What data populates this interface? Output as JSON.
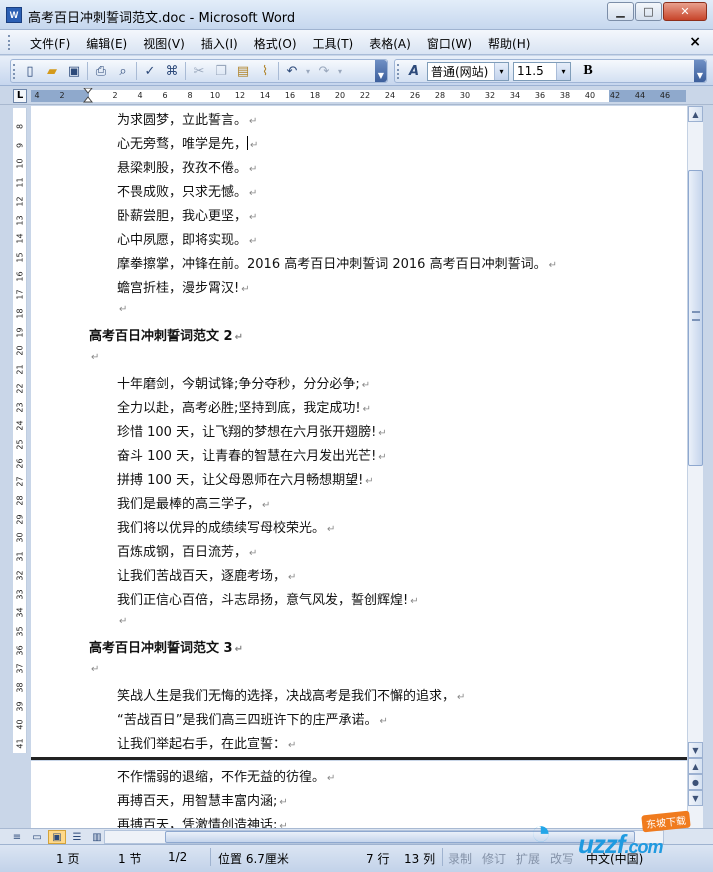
{
  "window": {
    "title": "高考百日冲刺誓词范文.doc - Microsoft Word",
    "app_icon_label": "W",
    "minimize_glyph": "▁",
    "maximize_glyph": "□",
    "close_glyph": "✕"
  },
  "menu": {
    "items": [
      "文件(F)",
      "编辑(E)",
      "视图(V)",
      "插入(I)",
      "格式(O)",
      "工具(T)",
      "表格(A)",
      "窗口(W)",
      "帮助(H)"
    ],
    "close_glyph": "×"
  },
  "toolbar": {
    "style_value": "普通(网站)",
    "font_size_value": "11.5",
    "bold_label": "B",
    "styles_icon_label": "A"
  },
  "ruler": {
    "corner_label": "L",
    "h_ticks": [
      "4",
      "2",
      "2",
      "4",
      "6",
      "8",
      "10",
      "12",
      "14",
      "16",
      "18",
      "20",
      "22",
      "24",
      "26",
      "28",
      "30",
      "32",
      "34",
      "36",
      "38",
      "40",
      "42",
      "44",
      "46"
    ],
    "v_ticks": [
      "8",
      "9",
      "10",
      "11",
      "12",
      "13",
      "14",
      "15",
      "16",
      "17",
      "18",
      "19",
      "20",
      "21",
      "22",
      "23",
      "24",
      "25",
      "26",
      "27",
      "28",
      "29",
      "30",
      "31",
      "32",
      "33",
      "34",
      "35",
      "36",
      "37",
      "38",
      "39",
      "40",
      "41"
    ]
  },
  "document": {
    "para_mark": "↵",
    "lines": [
      {
        "text": "为求圆梦，立此誓言。",
        "indent": 1
      },
      {
        "text": "心无旁骛，唯学是先，",
        "indent": 1,
        "caret": true
      },
      {
        "text": "悬梁刺股，孜孜不倦。",
        "indent": 1
      },
      {
        "text": "不畏成败，只求无憾。",
        "indent": 1
      },
      {
        "text": "卧薪尝胆，我心更坚，",
        "indent": 1
      },
      {
        "text": "心中夙愿，即将实现。",
        "indent": 1
      },
      {
        "text": "摩拳擦掌，冲锋在前。2016 高考百日冲刺誓词 2016 高考百日冲刺誓词。",
        "indent": 1
      },
      {
        "text": "蟾宫折桂，漫步霄汉!",
        "indent": 1
      },
      {
        "text": "",
        "indent": 1
      },
      {
        "text": "高考百日冲刺誓词范文 2",
        "indent": 0,
        "heading": true
      },
      {
        "text": "",
        "indent": 0
      },
      {
        "text": "十年磨剑，今朝试锋;争分夺秒，分分必争;",
        "indent": 1
      },
      {
        "text": "全力以赴，高考必胜;坚持到底，我定成功!",
        "indent": 1
      },
      {
        "text": "珍惜 100 天，让飞翔的梦想在六月张开翅膀!",
        "indent": 1
      },
      {
        "text": "奋斗 100 天，让青春的智慧在六月发出光芒!",
        "indent": 1
      },
      {
        "text": "拼搏 100 天，让父母恩师在六月畅想期望!",
        "indent": 1
      },
      {
        "text": "我们是最棒的高三学子，",
        "indent": 1
      },
      {
        "text": "我们将以优异的成绩续写母校荣光。",
        "indent": 1
      },
      {
        "text": "百炼成钢，百日流芳，",
        "indent": 1
      },
      {
        "text": "让我们苦战百天，逐鹿考场，",
        "indent": 1
      },
      {
        "text": "我们正信心百倍，斗志昂扬，意气风发，誓创辉煌!",
        "indent": 1
      },
      {
        "text": "",
        "indent": 1
      },
      {
        "text": "高考百日冲刺誓词范文 3",
        "indent": 0,
        "heading": true
      },
      {
        "text": "",
        "indent": 0
      },
      {
        "text": "笑战人生是我们无悔的选择，决战高考是我们不懈的追求，",
        "indent": 1
      },
      {
        "text": "“苦战百日”是我们高三四班许下的庄严承诺。",
        "indent": 1
      },
      {
        "text": "让我们举起右手，在此宣誓：",
        "indent": 1
      }
    ],
    "lower_lines": [
      {
        "text": "不作懦弱的退缩，不作无益的彷徨。",
        "indent": 1
      },
      {
        "text": "再搏百天，用智慧丰富内涵;",
        "indent": 1
      },
      {
        "text": "再搏百天，凭激情创造神话;",
        "indent": 1
      }
    ]
  },
  "statusbar": {
    "page": "1 页",
    "section": "1 节",
    "page_of": "1/2",
    "position": "位置 6.7厘米",
    "line": "7 行",
    "column": "13 列",
    "rec": "录制",
    "trk": "修订",
    "ext": "扩展",
    "ovr": "改写",
    "language": "中文(中国)"
  },
  "watermark": {
    "brand": "uzzf",
    "domain": ".com",
    "tag": "东坡下载"
  }
}
